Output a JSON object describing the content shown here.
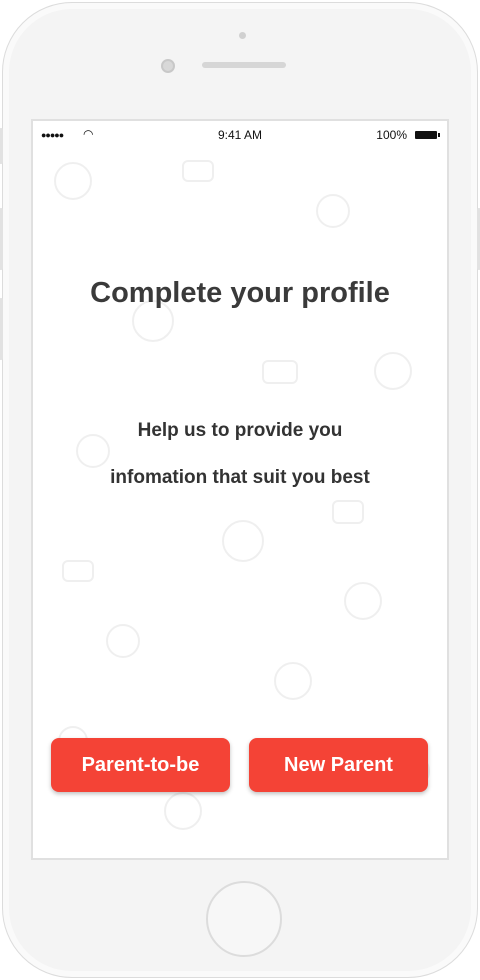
{
  "status_bar": {
    "time": "9:41 AM",
    "battery": "100%",
    "signal_icon": "signal-dots-icon",
    "wifi_icon": "wifi-icon"
  },
  "title": "Complete your profile",
  "subtitle": [
    "Help us to provide you",
    "infomation that suit you best"
  ],
  "buttons": {
    "parent_to_be": "Parent-to-be",
    "new_parent": "New Parent"
  },
  "colors": {
    "accent": "#f44336",
    "text": "#3a3a3a"
  }
}
